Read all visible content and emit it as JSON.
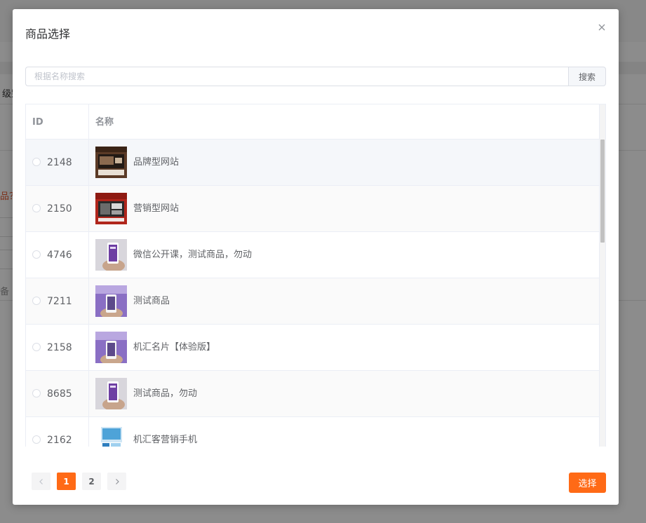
{
  "background": {
    "level_label": "级别",
    "warn_text": "品？",
    "field_hint": "备"
  },
  "modal": {
    "title": "商品选择",
    "close_icon": "close-icon",
    "search": {
      "placeholder": "根据名称搜索",
      "button_label": "搜索"
    },
    "table": {
      "columns": [
        "ID",
        "名称"
      ],
      "rows": [
        {
          "id": "2148",
          "name": "品牌型网站",
          "thumb": "brand-site"
        },
        {
          "id": "2150",
          "name": "营销型网站",
          "thumb": "marketing-site"
        },
        {
          "id": "4746",
          "name": "微信公开课，测试商品，勿动",
          "thumb": "phone-hand-gray"
        },
        {
          "id": "7211",
          "name": "测试商品",
          "thumb": "phone-hand-purple"
        },
        {
          "id": "2158",
          "name": "机汇名片【体验版】",
          "thumb": "phone-hand-purple"
        },
        {
          "id": "8685",
          "name": "测试商品，勿动",
          "thumb": "phone-hand-gray"
        },
        {
          "id": "2162",
          "name": "机汇客营销手机",
          "thumb": "blue-devices"
        }
      ]
    },
    "pagination": {
      "prev_icon": "chevron-left-icon",
      "next_icon": "chevron-right-icon",
      "pages": [
        "1",
        "2"
      ],
      "current": "1"
    },
    "confirm_label": "选择",
    "accent_color": "#ff6a16"
  }
}
